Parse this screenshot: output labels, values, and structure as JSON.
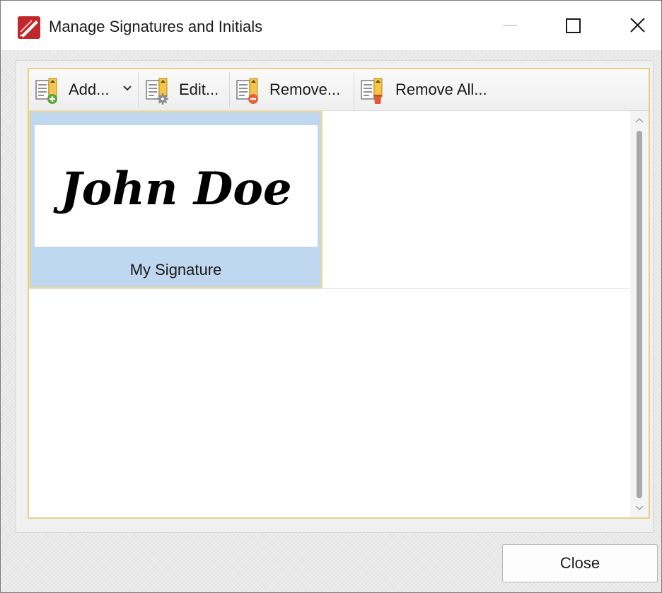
{
  "window": {
    "title": "Manage Signatures and Initials"
  },
  "toolbar": {
    "add_label": "Add...",
    "edit_label": "Edit...",
    "remove_label": "Remove...",
    "remove_all_label": "Remove All..."
  },
  "signatures": [
    {
      "preview_text": "John Doe",
      "name": "My Signature",
      "selected": true
    }
  ],
  "footer": {
    "close_label": "Close"
  },
  "colors": {
    "selection": "#bfd8ef",
    "selection_border": "#eed98f",
    "frame_border": "#e6d08a",
    "app_icon": "#c0272d"
  }
}
